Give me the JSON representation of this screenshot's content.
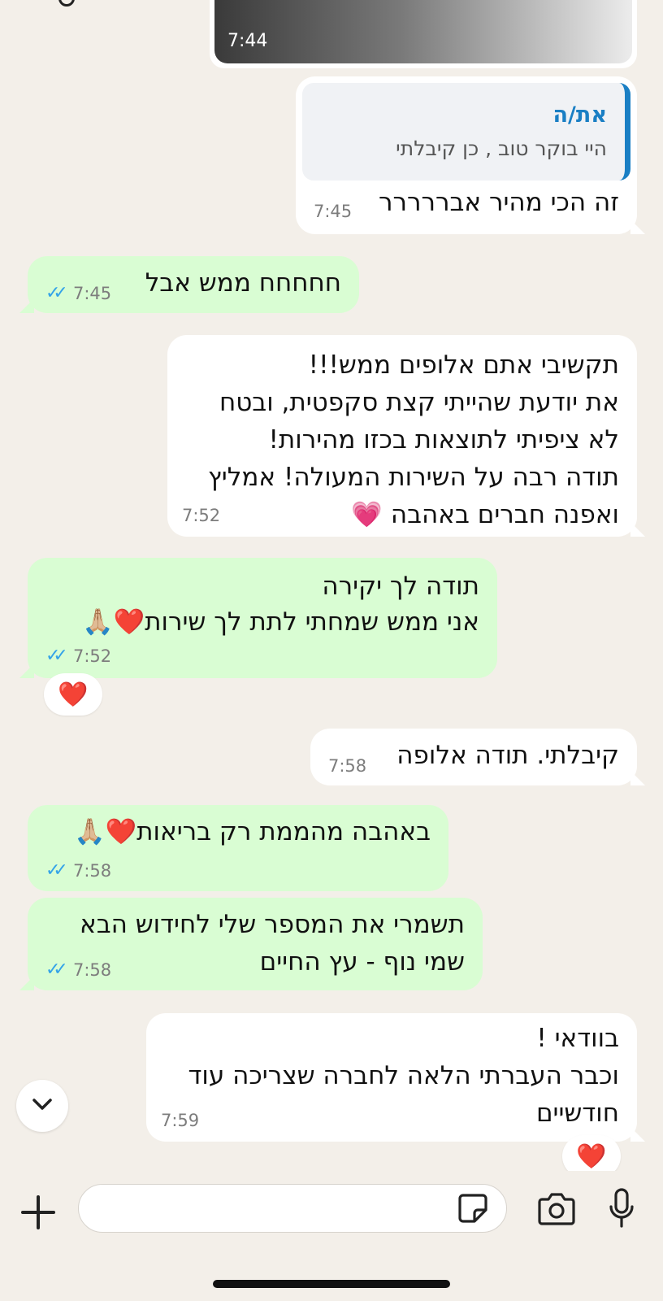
{
  "chat": {
    "media_message": {
      "time": "7:44"
    },
    "messages": [
      {
        "direction": "incoming",
        "quote_author": "את/ה",
        "quote_text": "היי בוקר טוב , כן קיבלתי",
        "text": "זה הכי מהיר אבררררר",
        "time": "7:45"
      },
      {
        "direction": "outgoing",
        "text": "חחחחח ממש אבל",
        "time": "7:45",
        "status": "read"
      },
      {
        "direction": "incoming",
        "lines": [
          "תקשיבי אתם אלופים ממש!!!",
          "את יודעת שהייתי קצת סקפטית, ובטח",
          "לא ציפיתי לתוצאות בכזו מהירות!",
          "תודה רבה על השירות המעולה! אמליץ",
          "ואפנה חברים באהבה 💗"
        ],
        "time": "7:52"
      },
      {
        "direction": "outgoing",
        "lines": [
          "תודה לך יקירה",
          "אני ממש שמחתי לתת לך שירות❤️🙏🏼"
        ],
        "time": "7:52",
        "status": "read",
        "reaction": "❤️"
      },
      {
        "direction": "incoming",
        "text": "קיבלתי. תודה אלופה",
        "time": "7:58"
      },
      {
        "direction": "outgoing",
        "text": "באהבה מהממת רק בריאות❤️🙏🏼",
        "time": "7:58",
        "status": "read"
      },
      {
        "direction": "outgoing",
        "lines": [
          "תשמרי את המספר שלי לחידוש הבא",
          "שמי נוף - עץ החיים"
        ],
        "time": "7:58",
        "status": "read"
      },
      {
        "direction": "incoming",
        "lines": [
          "בוודאי !",
          "וכבר העברתי הלאה לחברה שצריכה עוד",
          "חודשיים"
        ],
        "time": "7:59",
        "reaction": "❤️"
      }
    ]
  },
  "composer": {
    "input_value": "",
    "input_placeholder": ""
  },
  "icons": {
    "scroll_down": "chevron-down-icon",
    "attach": "plus-icon",
    "sticker": "sticker-icon",
    "camera": "camera-icon",
    "mic": "microphone-icon",
    "read_receipt": "double-check-icon"
  },
  "colors": {
    "background": "#f3efe9",
    "incoming_bubble": "#ffffff",
    "outgoing_bubble": "#d9fdd3",
    "read_ticks": "#34a3e8",
    "quote_accent": "#1a7fc4"
  }
}
